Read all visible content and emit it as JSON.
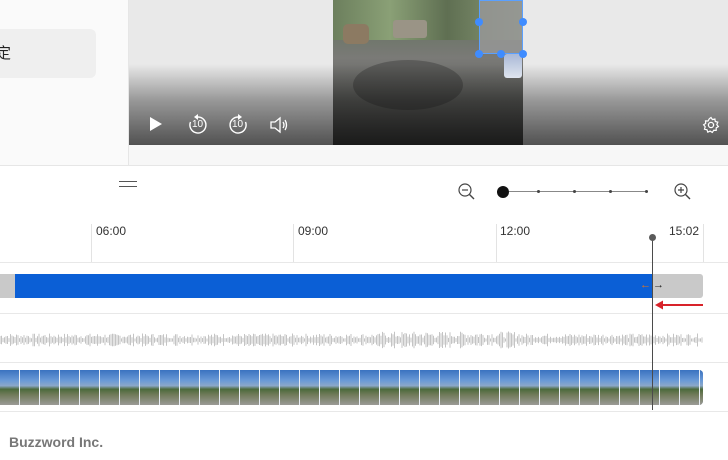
{
  "settings_panel": {
    "label": "定"
  },
  "player": {
    "controls": [
      {
        "name": "play-icon",
        "label": ""
      },
      {
        "name": "rewind-10-icon",
        "label": "10"
      },
      {
        "name": "forward-10-icon",
        "label": "10"
      },
      {
        "name": "volume-icon",
        "label": ""
      },
      {
        "name": "gear-icon",
        "label": ""
      }
    ]
  },
  "timeline": {
    "ticks": [
      "06:00",
      "09:00",
      "12:00",
      "15:02"
    ],
    "zoom_level": 0,
    "zoom_steps": 5
  },
  "colors": {
    "clip_selected": "#0b5fd6",
    "clip_trimmed": "#c9c9c9",
    "trim_arrow": "#e3731a",
    "pointer_arrow": "#d8232a",
    "handle": "#3f8cff"
  },
  "footer": {
    "company": "Buzzword Inc."
  }
}
